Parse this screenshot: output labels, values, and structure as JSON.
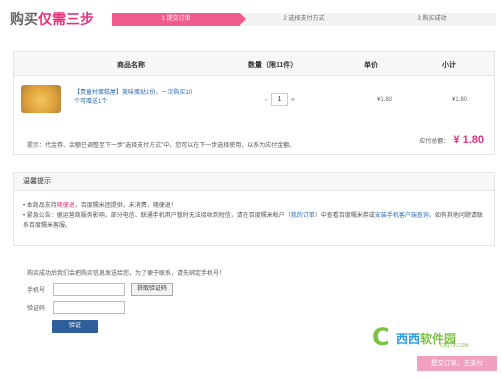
{
  "header": {
    "title_part1": "购买",
    "title_part2": "仅需三步",
    "steps": [
      "1 提交订单",
      "2 选择支付方式",
      "3 购买成功"
    ]
  },
  "cart": {
    "columns": [
      "商品名称",
      "数量（限11件）",
      "单价",
      "小计"
    ],
    "item": {
      "name": "【贵童村蛋糕屋】美味蛋挞1份，一次购买10个可赠送1个",
      "qty_minus": "-",
      "qty": "1",
      "qty_plus": "+",
      "unit_price": "¥1.80",
      "subtotal": "¥1.80"
    },
    "tip": "提示：代金券、余额已调整至下一步\"选择支付方式\"中，您可以在下一步选择使用，以系为应付金额。",
    "total_label": "应付总额：",
    "total_amount": "¥ 1.80"
  },
  "notice": {
    "heading": "温馨提示",
    "line1_a": "• 本商品支持",
    "line1_hl": "随便退",
    "line1_b": "，百度糯米团提供，未消费，随便退！",
    "line2_a": "• 紧急公告：据运营商服务影响，部分电信、联通手机用户暂时无法接收到短信，请在百度糯米帐户（",
    "line2_lk1": "我的订单",
    "line2_b": "）中查看百度糯米券或",
    "line2_lk2": "安装手机客户端查询",
    "line2_c": "，如有其他问题请联系百度糯米客服。"
  },
  "bind": {
    "tip": "购买成功后我们会把购买信息发送给您，为了便于联系，请先绑定手机号！",
    "phone_label": "手机号",
    "code_button": "获取验证码",
    "code_label": "验证码",
    "verify_button": "验证"
  },
  "logo": {
    "c": "C",
    "main_1": "西西",
    "main_2": "软件园",
    "sub": "CR173.COM"
  },
  "next_button": "提交订单，去支付",
  "colors": {
    "accent": "#e4327b",
    "step_active": "#ee5d8e",
    "link": "#2b6bb4",
    "verify_bg": "#2f5f9a",
    "next_bg": "#f2a0bf"
  }
}
